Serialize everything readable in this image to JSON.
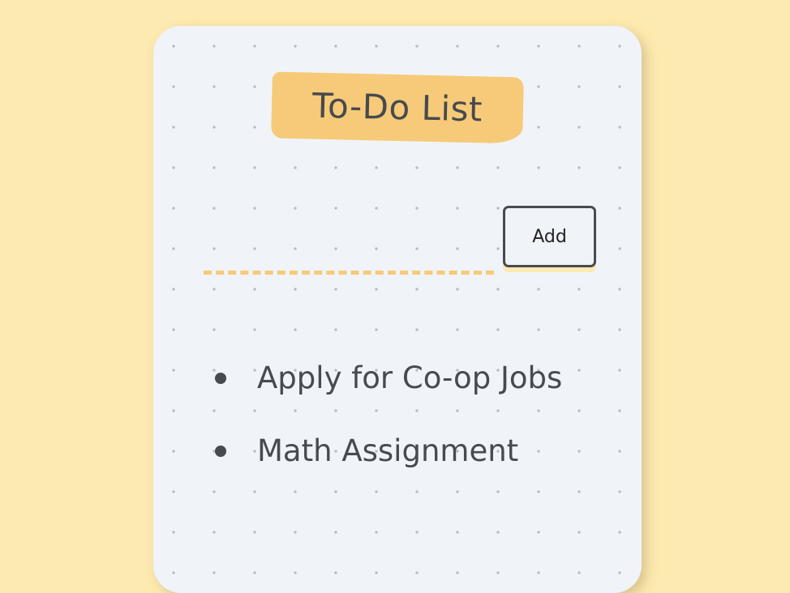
{
  "app": {
    "title": "To-Do List"
  },
  "form": {
    "input_value": "",
    "input_placeholder": "",
    "add_label": "Add"
  },
  "todos": [
    {
      "text": "Apply for Co-op Jobs"
    },
    {
      "text": "Math Assignment"
    }
  ],
  "colors": {
    "background": "#fdeab0",
    "card": "#f0f4f8",
    "accent": "#f6ca78",
    "text": "#474a4e"
  }
}
